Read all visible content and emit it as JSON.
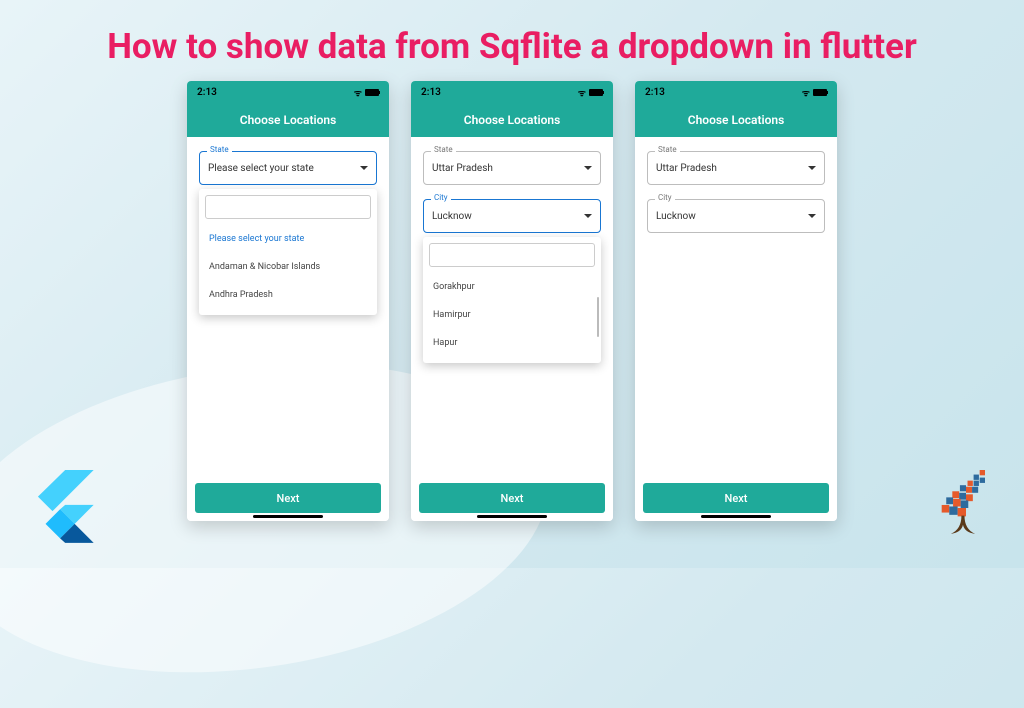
{
  "page_title": "How to show data from Sqflite a dropdown in flutter",
  "colors": {
    "accent": "#1faa9a",
    "title": "#e91e63",
    "focus": "#1976d2"
  },
  "phones": [
    {
      "status_time": "2:13",
      "app_title": "Choose Locations",
      "state_field": {
        "label": "State",
        "value": "Please select your state",
        "focused": true
      },
      "city_field": null,
      "dropdown": {
        "attached_to": "state",
        "search_value": "",
        "items": [
          {
            "text": "Please select your state",
            "selected": true
          },
          {
            "text": "Andaman & Nicobar Islands",
            "selected": false
          },
          {
            "text": "Andhra Pradesh",
            "selected": false
          }
        ]
      },
      "next_label": "Next"
    },
    {
      "status_time": "2:13",
      "app_title": "Choose Locations",
      "state_field": {
        "label": "State",
        "value": "Uttar Pradesh",
        "focused": false
      },
      "city_field": {
        "label": "City",
        "value": "Lucknow",
        "focused": true
      },
      "dropdown": {
        "attached_to": "city",
        "search_value": "",
        "items": [
          {
            "text": "Gorakhpur",
            "selected": false
          },
          {
            "text": "Hamirpur",
            "selected": false
          },
          {
            "text": "Hapur",
            "selected": false
          }
        ]
      },
      "next_label": "Next"
    },
    {
      "status_time": "2:13",
      "app_title": "Choose Locations",
      "state_field": {
        "label": "State",
        "value": "Uttar Pradesh",
        "focused": false
      },
      "city_field": {
        "label": "City",
        "value": "Lucknow",
        "focused": false
      },
      "dropdown": null,
      "next_label": "Next"
    }
  ]
}
